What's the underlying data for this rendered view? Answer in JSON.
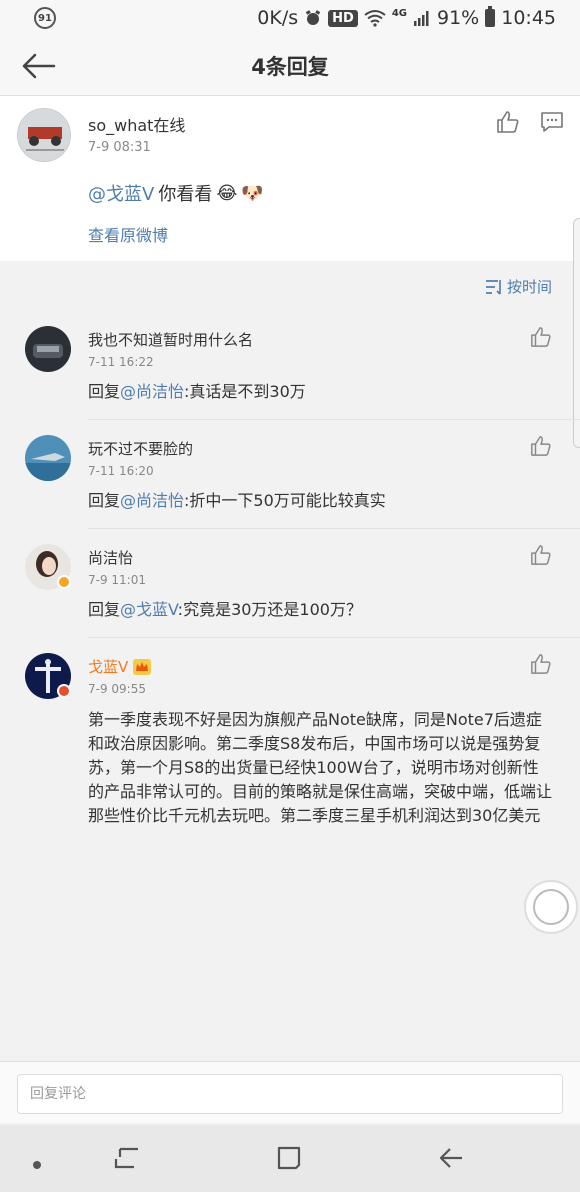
{
  "status_bar": {
    "notif": "91",
    "net_speed": "0K/s",
    "hd": "HD",
    "net_type": "4G",
    "battery": "91%",
    "time": "10:45"
  },
  "header": {
    "title": "4条回复"
  },
  "main_post": {
    "user": "so_what在线",
    "time": "7-9 08:31",
    "mention": "@戈蓝V",
    "text": " 你看看",
    "emoji1": "😂",
    "emoji2": "🐶",
    "view_original": "查看原微博"
  },
  "sort": {
    "label": "按时间"
  },
  "replies": [
    {
      "name": "我也不知道暂时用什么名",
      "time": "7-11 16:22",
      "prefix": "回复",
      "mention": "@尚洁怡",
      "text": ":真话是不到30万"
    },
    {
      "name": "玩不过不要脸的",
      "time": "7-11 16:20",
      "prefix": "回复",
      "mention": "@尚洁怡",
      "text": ":折中一下50万可能比较真实"
    },
    {
      "name": "尚洁怡",
      "time": "7-9 11:01",
      "prefix": "回复",
      "mention": "@戈蓝V",
      "text": ":究竟是30万还是100万？"
    },
    {
      "name": "戈蓝V",
      "time": "7-9 09:55",
      "text": "第一季度表现不好是因为旗舰产品Note缺席，同是Note7后遗症和政治原因影响。第二季度S8发布后，中国市场可以说是强势复苏，第一个月S8的出货量已经快100W台了，说明市场对创新性的产品非常认可的。目前的策略就是保住高端，突破中端，低端让那些性价比千元机去玩吧。第二季度三星手机利润达到30亿美元"
    }
  ],
  "reply_bar": {
    "placeholder": "回复评论"
  },
  "colors": {
    "link": "#507daf",
    "orange_name": "#f37b1d",
    "badge": "#f5a623"
  },
  "icons": [
    "back-arrow-icon",
    "thumbs-up-icon",
    "comment-icon",
    "sort-icon",
    "crown-icon",
    "nav-dot-icon",
    "recent-apps-icon",
    "home-icon",
    "nav-back-icon"
  ]
}
